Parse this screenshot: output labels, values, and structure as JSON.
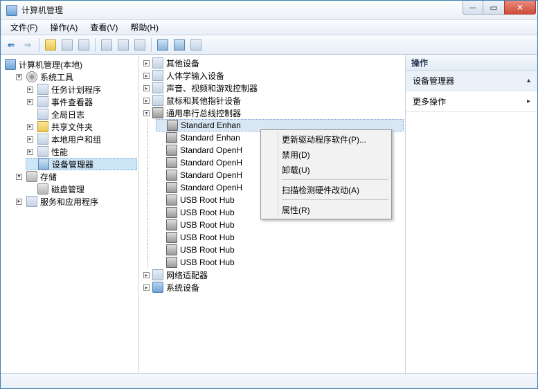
{
  "window": {
    "title": "计算机管理"
  },
  "menubar": [
    {
      "label": "文件(F)"
    },
    {
      "label": "操作(A)"
    },
    {
      "label": "查看(V)"
    },
    {
      "label": "帮助(H)"
    }
  ],
  "left_tree": {
    "root": "计算机管理(本地)",
    "system_tools": "系统工具",
    "task_scheduler": "任务计划程序",
    "event_viewer": "事件查看器",
    "global_log": "全局日志",
    "shared_folders": "共享文件夹",
    "local_users": "本地用户和组",
    "performance": "性能",
    "device_manager": "设备管理器",
    "storage": "存储",
    "disk_mgmt": "磁盘管理",
    "services_apps": "服务和应用程序"
  },
  "device_tree": {
    "other_devices": "其他设备",
    "hid": "人体学输入设备",
    "sound": "声音、视频和游戏控制器",
    "mouse": "鼠标和其他指针设备",
    "usb_controllers": "通用串行总线控制器",
    "usb_items": [
      "Standard Enhan",
      "Standard Enhan",
      "Standard OpenH",
      "Standard OpenH",
      "Standard OpenH",
      "Standard OpenH",
      "USB Root Hub",
      "USB Root Hub",
      "USB Root Hub",
      "USB Root Hub",
      "USB Root Hub",
      "USB Root Hub"
    ],
    "network_adapters": "网络适配器",
    "system_devices": "系统设备"
  },
  "context_menu": {
    "update_driver": "更新驱动程序软件(P)...",
    "disable": "禁用(D)",
    "uninstall": "卸载(U)",
    "scan": "扫描检测硬件改动(A)",
    "properties": "属性(R)"
  },
  "right_pane": {
    "header": "操作",
    "section_title": "设备管理器",
    "more_actions": "更多操作"
  },
  "toggle": {
    "expanded": "▾",
    "collapsed": "▸",
    "plus": "+",
    "minus": "−"
  }
}
